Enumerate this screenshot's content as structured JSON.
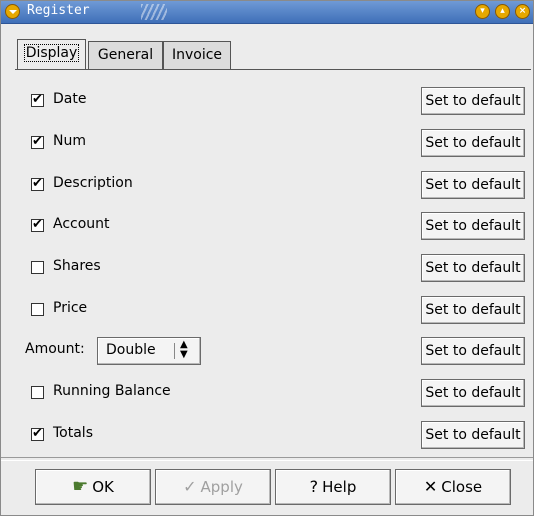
{
  "window": {
    "title": "Register"
  },
  "tabs": [
    {
      "label": "Display",
      "active": true
    },
    {
      "label": "General",
      "active": false
    },
    {
      "label": "Invoice",
      "active": false
    }
  ],
  "rows": [
    {
      "kind": "check",
      "label": "Date",
      "checked": true,
      "button": "Set to default"
    },
    {
      "kind": "check",
      "label": "Num",
      "checked": true,
      "button": "Set to default"
    },
    {
      "kind": "check",
      "label": "Description",
      "checked": true,
      "button": "Set to default"
    },
    {
      "kind": "check",
      "label": "Account",
      "checked": true,
      "button": "Set to default"
    },
    {
      "kind": "check",
      "label": "Shares",
      "checked": false,
      "button": "Set to default"
    },
    {
      "kind": "check",
      "label": "Price",
      "checked": false,
      "button": "Set to default"
    },
    {
      "kind": "combo",
      "label": "Amount:",
      "value": "Double",
      "button": "Set to default"
    },
    {
      "kind": "check",
      "label": "Running Balance",
      "checked": false,
      "button": "Set to default"
    },
    {
      "kind": "check",
      "label": "Totals",
      "checked": true,
      "button": "Set to default"
    }
  ],
  "checkmark_glyph": "✔",
  "buttons": {
    "ok": {
      "label": "OK",
      "icon": "ok-hand-icon",
      "enabled": true
    },
    "apply": {
      "label": "Apply",
      "icon": "check-icon",
      "enabled": false
    },
    "help": {
      "label": "Help",
      "icon": "question-icon",
      "enabled": true
    },
    "close": {
      "label": "Close",
      "icon": "x-icon",
      "enabled": true
    }
  },
  "colors": {
    "titlebar": "#3f6fb8",
    "window_bg": "#ececec",
    "disabled_text": "#a0a0a0"
  }
}
